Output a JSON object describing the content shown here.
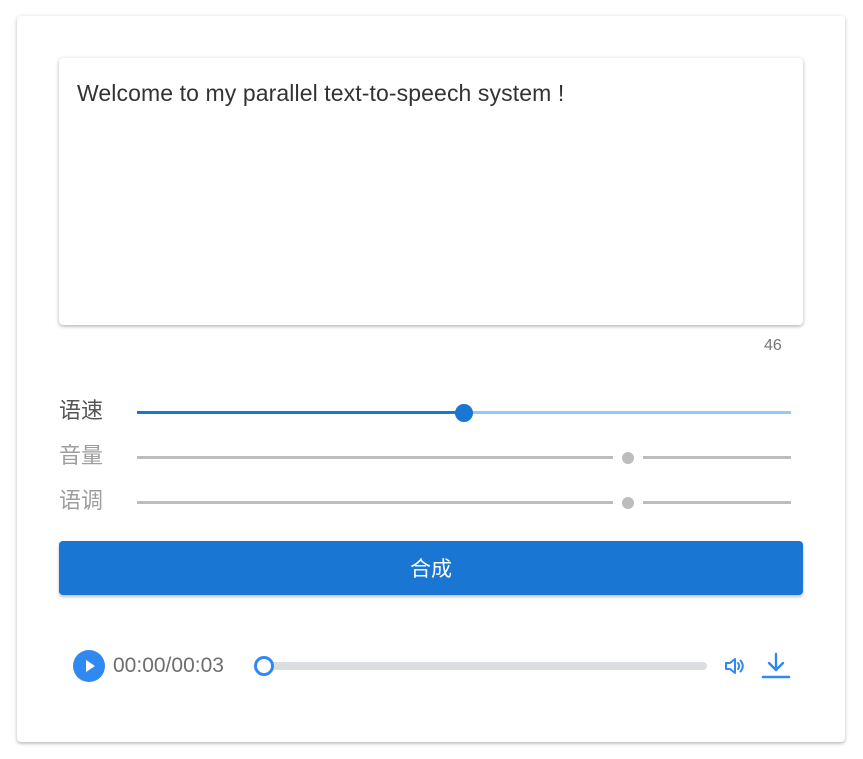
{
  "text_input": {
    "value": "Welcome to my parallel text-to-speech system !",
    "char_count": "46"
  },
  "sliders": [
    {
      "label": "语速",
      "value_fraction": 0.5,
      "enabled": true
    },
    {
      "label": "音量",
      "value_fraction": 0.75,
      "enabled": false
    },
    {
      "label": "语调",
      "value_fraction": 0.75,
      "enabled": false
    }
  ],
  "synthesize_button": {
    "label": "合成"
  },
  "player": {
    "time": "00:00/00:03",
    "progress_fraction": 0,
    "icons": [
      "play-icon",
      "volume-icon",
      "download-icon"
    ]
  },
  "colors": {
    "primary": "#1976d2",
    "primary_light": "#90caf9",
    "disabled": "#bdbdbd",
    "player_accent": "#2f89f0"
  }
}
